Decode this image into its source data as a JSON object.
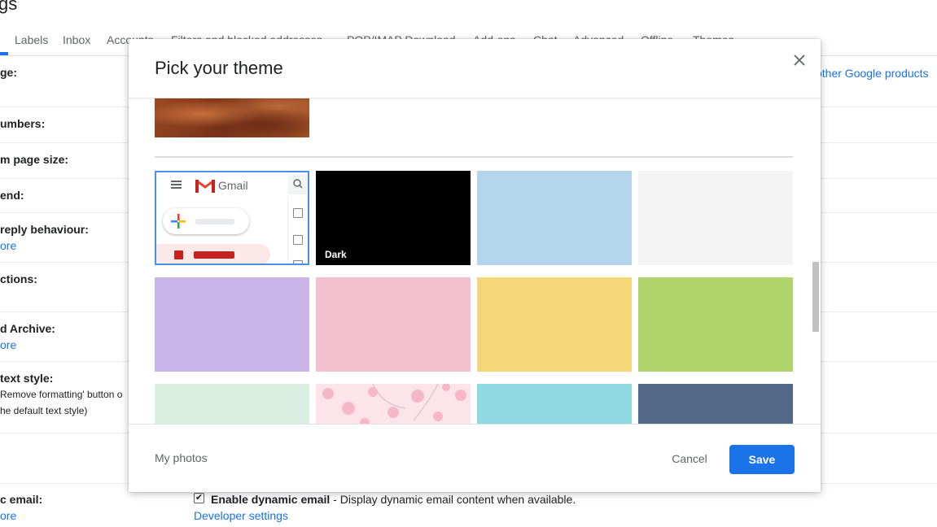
{
  "page": {
    "title_fragment": "gs"
  },
  "tabs": [
    "Labels",
    "Inbox",
    "Accounts",
    "Filters and blocked addresses",
    "POP/IMAP Download",
    "Add-ons",
    "Chat",
    "Advanced",
    "Offline",
    "Themes"
  ],
  "settings": {
    "language_label": "ge:",
    "phone_label": "umbers:",
    "max_page_label": "m page size:",
    "undo_send_label": "end:",
    "reply_label": "reply behaviour:",
    "reply_more": "ore",
    "hover_label": "ctions:",
    "send_archive_label": "d Archive:",
    "send_archive_more": "ore",
    "text_style_label": "text style:",
    "text_style_note1": "Remove formatting' button o",
    "text_style_note2": "he default text style)",
    "dynamic_label": "c email:",
    "dynamic_more": "ore",
    "other_products_link": "other Google products",
    "dynamic_check_mark": "✔",
    "dynamic_bold": "Enable dynamic email",
    "dynamic_desc": " - Display dynamic email content when available.",
    "developer_link": "Developer settings"
  },
  "modal": {
    "title": "Pick your theme",
    "close_icon": "close-icon",
    "default_theme": {
      "gmail_text": "Gmail"
    },
    "themes": [
      {
        "label": "Dark",
        "color": "#000000"
      },
      {
        "label": "",
        "color": "#b3d6ec"
      },
      {
        "label": "",
        "color": "#f4f4f4"
      },
      {
        "label": "",
        "color": "#c9b5e8"
      },
      {
        "label": "",
        "color": "#f4bfcf"
      },
      {
        "label": "",
        "color": "#f5d77a"
      },
      {
        "label": "",
        "color": "#afd56c"
      },
      {
        "label": "",
        "color": "#d9efe2"
      },
      {
        "label": "",
        "color": "#fde4eb"
      },
      {
        "label": "",
        "color": "#8fd9e0"
      },
      {
        "label": "",
        "color": "#536787"
      }
    ],
    "footer": {
      "my_photos": "My photos",
      "cancel": "Cancel",
      "save": "Save"
    }
  },
  "colors": {
    "accent": "#1a73e8",
    "selected_border": "#4a90e2"
  }
}
